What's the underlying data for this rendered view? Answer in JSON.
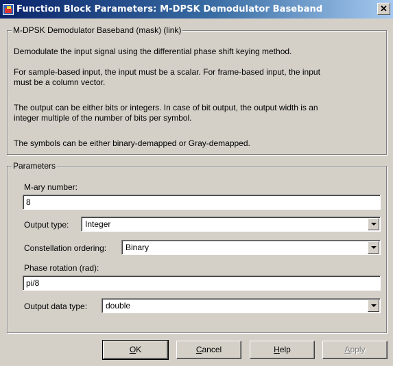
{
  "window": {
    "title": "Function Block Parameters: M-DPSK Demodulator Baseband",
    "close_glyph": "✕"
  },
  "description": {
    "legend": "M-DPSK Demodulator Baseband (mask) (link)",
    "lines": [
      "Demodulate the input signal using the differential phase shift keying method.",
      "For sample-based input, the input must be a scalar. For frame-based input, the input",
      "must be a column vector.",
      "The output can be either bits or integers. In case of bit output, the output width is an",
      "integer multiple of the number of bits per symbol.",
      "The symbols can be either binary-demapped or Gray-demapped."
    ]
  },
  "parameters": {
    "legend": "Parameters",
    "mary_label": "M-ary number:",
    "mary_value": "8",
    "output_type_label": "Output type:",
    "output_type_value": "Integer",
    "constellation_label": "Constellation ordering:",
    "constellation_value": "Binary",
    "phase_label": "Phase rotation (rad):",
    "phase_value": "pi/8",
    "datatype_label": "Output data type:",
    "datatype_value": "double"
  },
  "buttons": {
    "ok_mn": "O",
    "ok_rest": "K",
    "cancel_mn": "C",
    "cancel_rest": "ancel",
    "help_mn": "H",
    "help_rest": "elp",
    "apply_mn": "A",
    "apply_rest": "pply"
  },
  "colors": {
    "face": "#d4d0c8",
    "title_start": "#0a246a",
    "title_end": "#a6caf0"
  }
}
